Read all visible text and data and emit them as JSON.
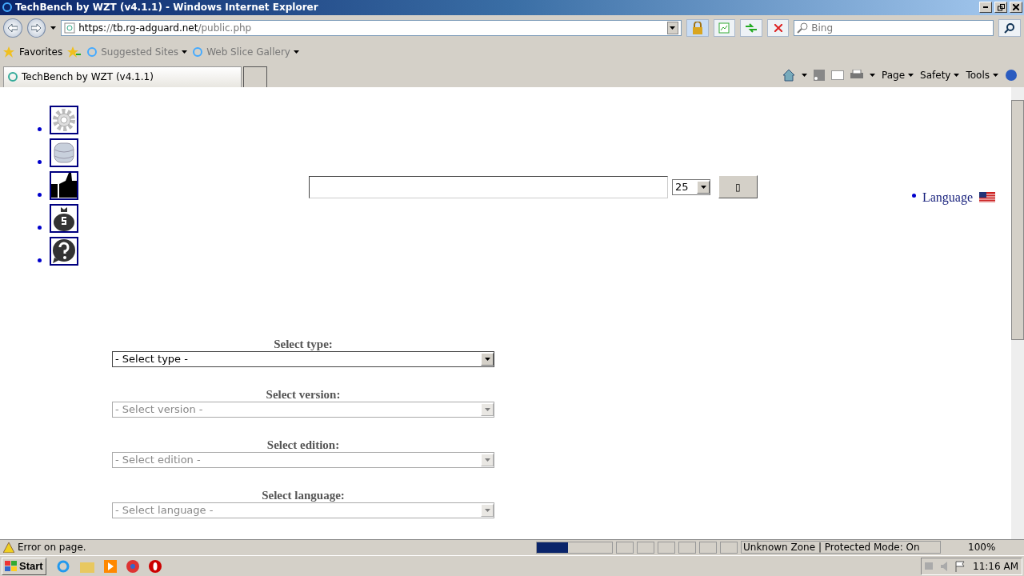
{
  "window": {
    "title": "TechBench by WZT (v4.1.1) - Windows Internet Explorer"
  },
  "address_bar": {
    "scheme": "https://",
    "host": "tb.rg-adguard.net",
    "path": "/public.php"
  },
  "search": {
    "placeholder": "Bing"
  },
  "favorites_bar": {
    "favorites": "Favorites",
    "items": [
      "Suggested Sites",
      "Web Slice Gallery"
    ]
  },
  "tabs": [
    {
      "label": "TechBench by WZT (v4.1.1)",
      "selected": true
    }
  ],
  "command_bar": [
    "Page",
    "Safety",
    "Tools"
  ],
  "page": {
    "nav_icons": [
      {
        "kind": "gear"
      },
      {
        "kind": "database"
      },
      {
        "kind": "thumb"
      },
      {
        "kind": "money"
      },
      {
        "kind": "help"
      }
    ],
    "page_size": "25",
    "search_button": "▯",
    "language": "Language",
    "form": [
      {
        "label": "Select type:",
        "value": "- Select type -",
        "disabled": false
      },
      {
        "label": "Select version:",
        "value": "- Select version -",
        "disabled": true
      },
      {
        "label": "Select edition:",
        "value": "- Select edition -",
        "disabled": true
      },
      {
        "label": "Select language:",
        "value": "- Select language -",
        "disabled": true
      }
    ]
  },
  "status_bar": {
    "message": "Error on page.",
    "progress": {
      "level": 0.42
    },
    "zone": "Unknown Zone | Protected Mode: On",
    "zoom": "100%"
  },
  "taskbar": {
    "start": "Start",
    "time": "11:16 AM"
  }
}
